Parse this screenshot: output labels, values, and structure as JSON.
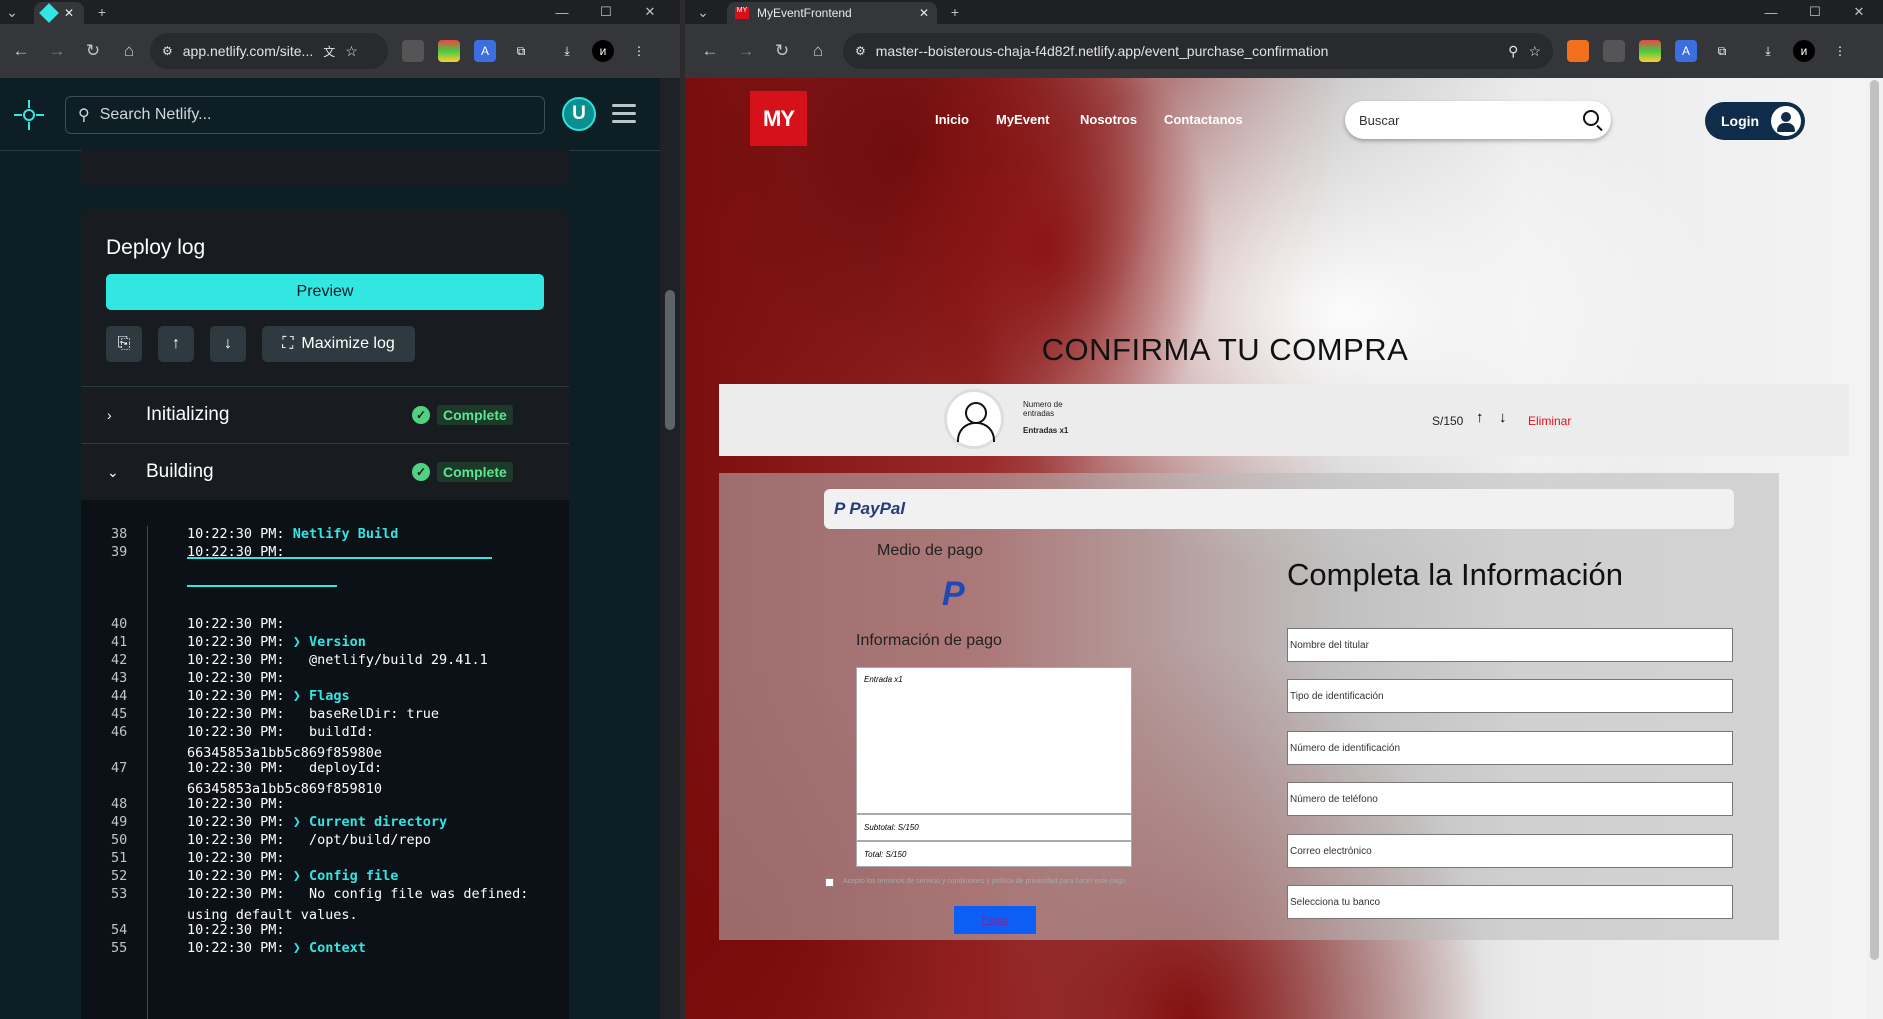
{
  "left_window": {
    "tab_favicon": "netlify-logo",
    "url": "app.netlify.com/site...",
    "search_placeholder": "Search Netlify...",
    "avatar_letter": "U",
    "deploy_log": {
      "title": "Deploy log",
      "preview_label": "Preview",
      "maximize_label": "Maximize log",
      "sections": [
        {
          "label": "Initializing",
          "status": "Complete"
        },
        {
          "label": "Building",
          "status": "Complete"
        }
      ],
      "lines": [
        {
          "n": "38",
          "time": "10:22:30 PM:",
          "text": "Netlify Build",
          "hl": true
        },
        {
          "n": "39",
          "time": "10:22:30 PM:",
          "text": "",
          "hl": false
        },
        {
          "n": "40",
          "time": "10:22:30 PM:",
          "text": "",
          "hl": false
        },
        {
          "n": "41",
          "time": "10:22:30 PM:",
          "text": "❯ Version",
          "hl": true
        },
        {
          "n": "42",
          "time": "10:22:30 PM:",
          "text": "  @netlify/build 29.41.1",
          "hl": false
        },
        {
          "n": "43",
          "time": "10:22:30 PM:",
          "text": "",
          "hl": false
        },
        {
          "n": "44",
          "time": "10:22:30 PM:",
          "text": "❯ Flags",
          "hl": true
        },
        {
          "n": "45",
          "time": "10:22:30 PM:",
          "text": "  baseRelDir: true",
          "hl": false
        },
        {
          "n": "46",
          "time": "10:22:30 PM:",
          "text": "  buildId:",
          "hl": false,
          "wrap": "66345853a1bb5c869f85980e"
        },
        {
          "n": "47",
          "time": "10:22:30 PM:",
          "text": "  deployId:",
          "hl": false,
          "wrap": "66345853a1bb5c869f859810"
        },
        {
          "n": "48",
          "time": "10:22:30 PM:",
          "text": "",
          "hl": false
        },
        {
          "n": "49",
          "time": "10:22:30 PM:",
          "text": "❯ Current directory",
          "hl": true
        },
        {
          "n": "50",
          "time": "10:22:30 PM:",
          "text": "  /opt/build/repo",
          "hl": false
        },
        {
          "n": "51",
          "time": "10:22:30 PM:",
          "text": "",
          "hl": false
        },
        {
          "n": "52",
          "time": "10:22:30 PM:",
          "text": "❯ Config file",
          "hl": true
        },
        {
          "n": "53",
          "time": "10:22:30 PM:",
          "text": "  No config file was defined:",
          "hl": false,
          "wrap": "using default values."
        },
        {
          "n": "54",
          "time": "10:22:30 PM:",
          "text": "",
          "hl": false
        },
        {
          "n": "55",
          "time": "10:22:30 PM:",
          "text": "❯ Context",
          "hl": true
        }
      ]
    }
  },
  "right_window": {
    "tab_title": "MyEventFrontend",
    "url": "master--boisterous-chaja-f4d82f.netlify.app/event_purchase_confirmation",
    "site": {
      "logo": "MY",
      "nav": [
        "Inicio",
        "MyEvent",
        "Nosotros",
        "Contactanos"
      ],
      "search_placeholder": "Buscar",
      "login_label": "Login",
      "page_title": "CONFIRMA TU COMPRA",
      "cart": {
        "qty_label": "Numero de entradas",
        "entries": "Entradas x1",
        "price": "S/150",
        "remove": "Eliminar"
      },
      "payment": {
        "paypal_label": "PayPal",
        "medio_label": "Medio de pago",
        "info_label": "Información de pago",
        "item": "Entrada x1",
        "subtotal": "Subtotal: S/150",
        "total": "Total: S/150",
        "terms": "Acepto los términos de servicio y condiciones y política de privacidad para hacer este pago",
        "pay_button": "Pagar",
        "form_title": "Completa la Información",
        "fields": [
          "Nombre del titular",
          "Tipo de identificación",
          "Número de identificación",
          "Número de teléfono",
          "Correo electrónico",
          "Selecciona tu banco"
        ]
      }
    }
  },
  "colors": {
    "netlify_teal": "#32e6e2",
    "complete_green": "#5ce68f",
    "brand_red": "#d5121a",
    "pay_blue": "#0d5ef7"
  }
}
